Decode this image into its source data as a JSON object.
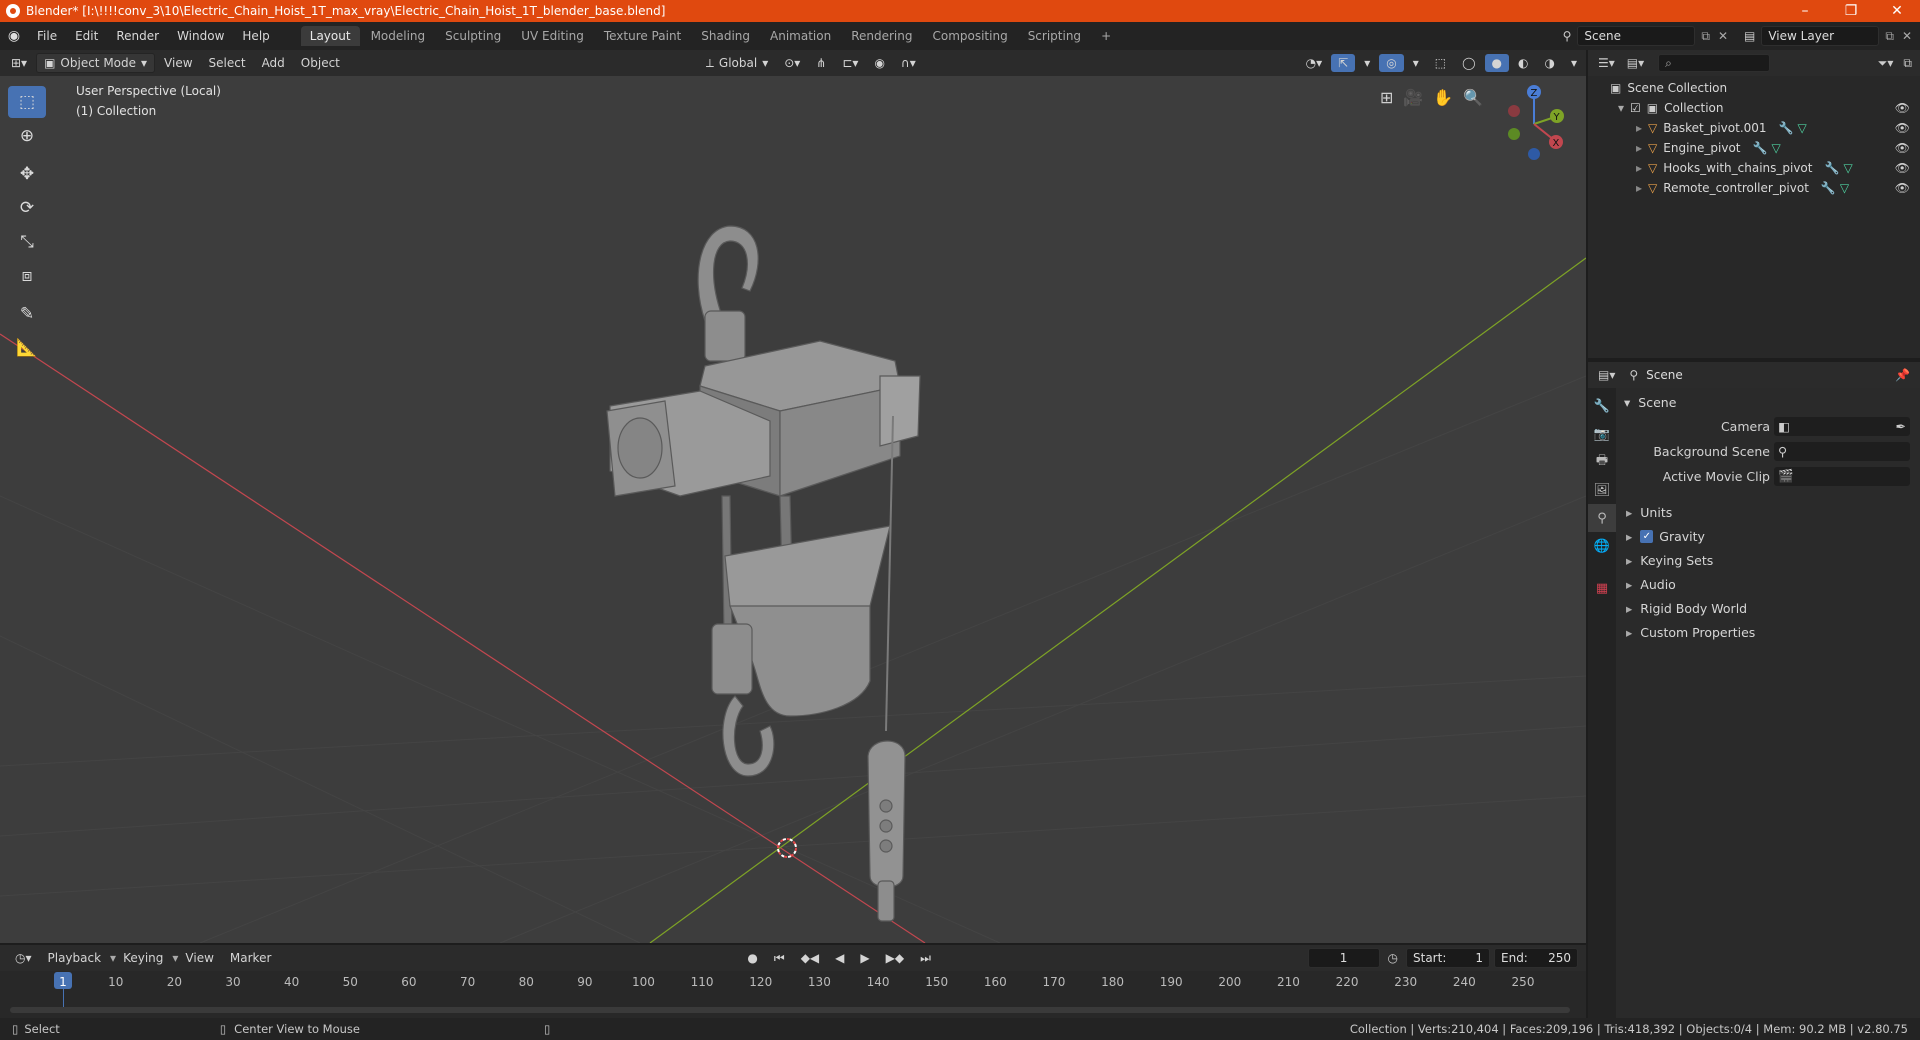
{
  "window": {
    "title": "Blender* [I:\\!!!!conv_3\\10\\Electric_Chain_Hoist_1T_max_vray\\Electric_Chain_Hoist_1T_blender_base.blend]",
    "minimize": "–",
    "maximize": "❐",
    "close": "✕"
  },
  "menu": [
    "File",
    "Edit",
    "Render",
    "Window",
    "Help"
  ],
  "workspaces": [
    "Layout",
    "Modeling",
    "Sculpting",
    "UV Editing",
    "Texture Paint",
    "Shading",
    "Animation",
    "Rendering",
    "Compositing",
    "Scripting",
    "+"
  ],
  "scene_field": "Scene",
  "view_layer_field": "View Layer",
  "viewport_header": {
    "mode": "Object Mode",
    "menus": [
      "View",
      "Select",
      "Add",
      "Object"
    ],
    "transform_orientation": "Global"
  },
  "viewport": {
    "perspective": "User Perspective (Local)",
    "collection": "(1) Collection",
    "gizmo_axes": [
      "Z",
      "Y",
      "X"
    ]
  },
  "outliner": {
    "scene_collection": "Scene Collection",
    "collection": "Collection",
    "objects": [
      "Basket_pivot.001",
      "Engine_pivot",
      "Hooks_with_chains_pivot",
      "Remote_controller_pivot"
    ]
  },
  "properties": {
    "header_title": "Scene",
    "panel_title": "Scene",
    "fields": [
      {
        "label": "Camera"
      },
      {
        "label": "Background Scene"
      },
      {
        "label": "Active Movie Clip"
      }
    ],
    "sections": [
      "Units",
      "Gravity",
      "Keying Sets",
      "Audio",
      "Rigid Body World",
      "Custom Properties"
    ]
  },
  "timeline": {
    "menus": [
      "Playback",
      "Keying",
      "View",
      "Marker"
    ],
    "current_frame": "1",
    "start_label": "Start:",
    "start": "1",
    "end_label": "End:",
    "end": "250",
    "ruler": [
      "1",
      "10",
      "20",
      "30",
      "40",
      "50",
      "60",
      "70",
      "80",
      "90",
      "100",
      "110",
      "120",
      "130",
      "140",
      "150",
      "160",
      "170",
      "180",
      "190",
      "200",
      "210",
      "220",
      "230",
      "240",
      "250"
    ]
  },
  "statusbar": {
    "left": "Select",
    "middle": "Center View to Mouse",
    "right": "Collection | Verts:210,404 | Faces:209,196 | Tris:418,392 | Objects:0/4 | Mem: 90.2 MB | v2.80.75"
  },
  "colors": {
    "title_bar": "#e0490f",
    "accent": "#4772b3",
    "x_axis": "#c2474f",
    "y_axis": "#7ea326",
    "object_icon": "#e8a04a"
  }
}
